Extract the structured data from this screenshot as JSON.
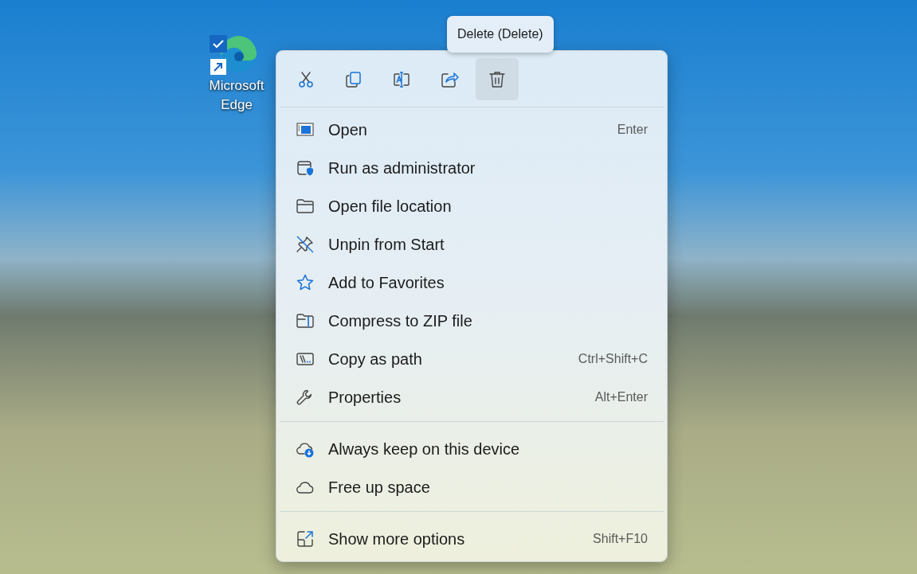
{
  "desktop_icons": [
    {
      "label": "Microsoft Edge",
      "checked": true,
      "shortcut": true
    }
  ],
  "tooltip": {
    "text": "Delete (Delete)"
  },
  "toolbar": [
    {
      "kind": "cut",
      "hovered": false
    },
    {
      "kind": "copy",
      "hovered": false
    },
    {
      "kind": "rename",
      "hovered": false
    },
    {
      "kind": "share",
      "hovered": false
    },
    {
      "kind": "delete",
      "hovered": true
    }
  ],
  "menu_groups": [
    [
      {
        "kind": "open",
        "label": "Open",
        "shortcut": "Enter"
      },
      {
        "kind": "admin",
        "label": "Run as administrator"
      },
      {
        "kind": "folder",
        "label": "Open file location"
      },
      {
        "kind": "unpin",
        "label": "Unpin from Start"
      },
      {
        "kind": "star",
        "label": "Add to Favorites"
      },
      {
        "kind": "zip",
        "label": "Compress to ZIP file"
      },
      {
        "kind": "path",
        "label": "Copy as path",
        "shortcut": "Ctrl+Shift+C"
      },
      {
        "kind": "wrench",
        "label": "Properties",
        "shortcut": "Alt+Enter"
      }
    ],
    [
      {
        "kind": "cloud-keep",
        "label": "Always keep on this device"
      },
      {
        "kind": "cloud",
        "label": "Free up space"
      }
    ],
    [
      {
        "kind": "more",
        "label": "Show more options",
        "shortcut": "Shift+F10"
      }
    ]
  ]
}
